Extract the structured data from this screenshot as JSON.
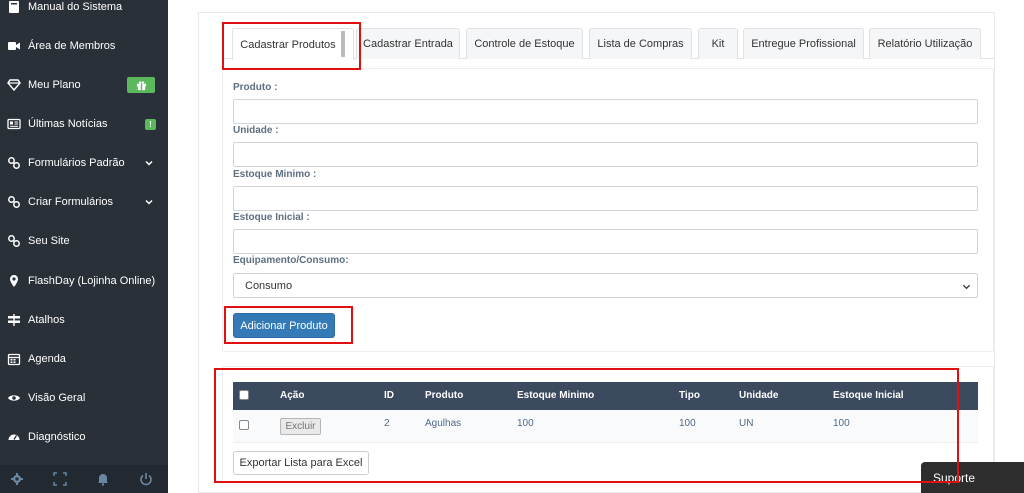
{
  "sidebar": {
    "items": [
      {
        "label": "Manual do Sistema",
        "icon": "book-icon"
      },
      {
        "label": "Área de Membros",
        "icon": "video-camera-icon"
      },
      {
        "label": "Meu Plano",
        "icon": "diamond-icon",
        "badge": "gift-icon"
      },
      {
        "label": "Últimas Notícias",
        "icon": "newspaper-icon",
        "badge_text": "!"
      },
      {
        "label": "Formulários Padrão",
        "icon": "link-icon",
        "chevron": true
      },
      {
        "label": "Criar Formulários",
        "icon": "link-icon",
        "chevron": true
      },
      {
        "label": "Seu Site",
        "icon": "link-icon"
      },
      {
        "label": "FlashDay (Lojinha Online)",
        "icon": "map-marker-icon"
      },
      {
        "label": "Atalhos",
        "icon": "signpost-icon"
      },
      {
        "label": "Agenda",
        "icon": "calendar-icon"
      },
      {
        "label": "Visão Geral",
        "icon": "eye-icon"
      },
      {
        "label": "Diagnóstico",
        "icon": "dashboard-icon"
      }
    ],
    "footer_icons": [
      "gear-icon",
      "fullscreen-icon",
      "bell-icon",
      "power-icon"
    ]
  },
  "tabs": [
    {
      "label": "Cadastrar Produtos",
      "active": true
    },
    {
      "label": "Cadastrar Entrada"
    },
    {
      "label": "Controle de Estoque"
    },
    {
      "label": "Lista de Compras"
    },
    {
      "label": "Kit"
    },
    {
      "label": "Entregue Profissional"
    },
    {
      "label": "Relatório Utilização"
    }
  ],
  "form": {
    "produto_label": "Produto :",
    "produto_value": "",
    "unidade_label": "Unidade :",
    "unidade_value": "",
    "estoque_minimo_label": "Estoque Minimo :",
    "estoque_minimo_value": "",
    "estoque_inicial_label": "Estoque Inicial :",
    "estoque_inicial_value": "",
    "tipo_label": "Equipamento/Consumo:",
    "tipo_selected": "Consumo",
    "submit_label": "Adicionar Produto"
  },
  "table": {
    "headers": [
      "Ação",
      "ID",
      "Produto",
      "Estoque Minimo",
      "Tipo",
      "Unidade",
      "Estoque Inicial"
    ],
    "rows": [
      {
        "action": "Excluir",
        "id": "2",
        "produto": "Agulhas",
        "estoque_minimo": "100",
        "tipo": "100",
        "unidade": "UN",
        "estoque_inicial": "100"
      }
    ],
    "export_label": "Exportar Lista para Excel"
  },
  "support": {
    "label": "Suporte"
  },
  "colors": {
    "sidebar_bg": "#2a3038",
    "table_header_bg": "#3b4a5e",
    "primary_button": "#337ab7",
    "badge_green": "#5cb85c",
    "highlight_red": "#e01010"
  }
}
